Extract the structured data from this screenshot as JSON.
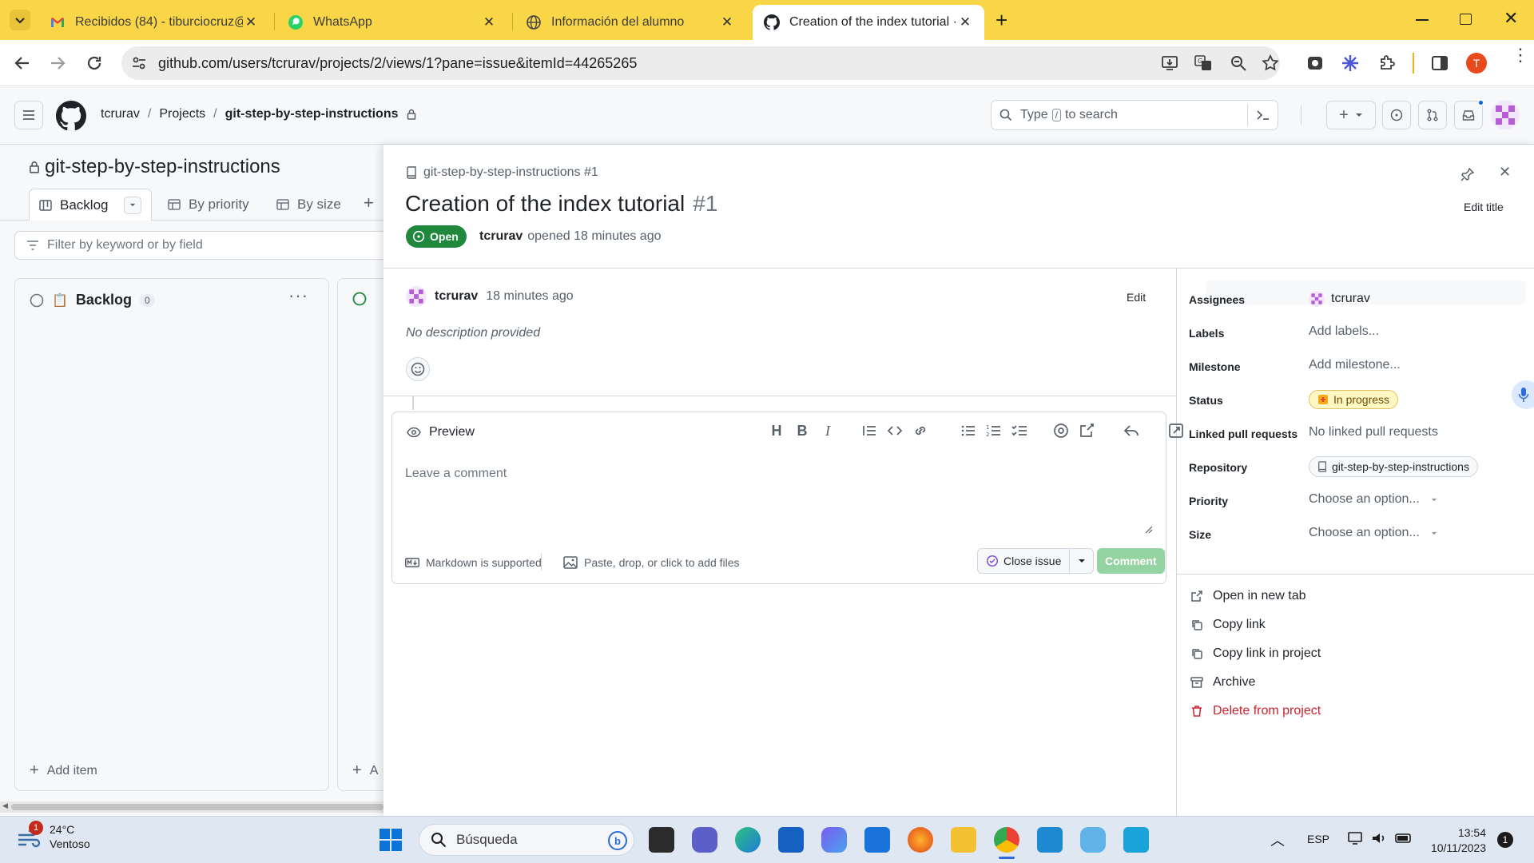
{
  "browser": {
    "tabs": [
      {
        "title": "Recibidos (84) - tiburciocruz@",
        "icon": "gmail-icon"
      },
      {
        "title": "WhatsApp",
        "icon": "whatsapp-icon"
      },
      {
        "title": "Información del alumno",
        "icon": "globe-icon"
      },
      {
        "title": "Creation of the index tutorial · g",
        "icon": "github-icon"
      }
    ],
    "url": "github.com/users/tcrurav/projects/2/views/1?pane=issue&itemId=44265265",
    "profile_letter": "T"
  },
  "github_header": {
    "breadcrumb": [
      "tcrurav",
      "/",
      "Projects",
      "/",
      "git-step-by-step-instructions"
    ],
    "search_placeholder_a": "Type",
    "search_key": "/",
    "search_placeholder_b": "to search",
    "new_button": "+"
  },
  "project": {
    "title": "git-step-by-step-instructions",
    "views": [
      "Backlog",
      "By priority",
      "By size"
    ],
    "add_view": "+",
    "filter_placeholder": "Filter by keyword or by field",
    "columns": [
      {
        "name": "Backlog",
        "count": "0",
        "add_label": "Add item"
      },
      {
        "name": "",
        "count": "",
        "add_label": "A"
      }
    ]
  },
  "issue": {
    "repo_ref": "git-step-by-step-instructions #1",
    "title": "Creation of the index tutorial",
    "number": "#1",
    "edit_title": "Edit title",
    "state": "Open",
    "author": "tcrurav",
    "opened_text": "opened 18 minutes ago",
    "comment_author": "tcrurav",
    "comment_time": "18 minutes ago",
    "comment_edit": "Edit",
    "description": "No description provided",
    "editor": {
      "preview_label": "Preview",
      "placeholder": "Leave a comment",
      "markdown_hint": "Markdown is supported",
      "attach_hint": "Paste, drop, or click to add files",
      "close_button": "Close issue",
      "comment_button": "Comment"
    }
  },
  "sidebar_meta": [
    {
      "label": "Assignees",
      "value": "tcrurav"
    },
    {
      "label": "Labels",
      "value": "Add labels..."
    },
    {
      "label": "Milestone",
      "value": "Add milestone..."
    },
    {
      "label": "Status",
      "value": "In progress"
    },
    {
      "label": "Linked pull requests",
      "value": "No linked pull requests"
    },
    {
      "label": "Repository",
      "value": "git-step-by-step-instructions"
    },
    {
      "label": "Priority",
      "value": "Choose an option..."
    },
    {
      "label": "Size",
      "value": "Choose an option..."
    }
  ],
  "actions": [
    {
      "label": "Open in new tab",
      "icon": "external-link-icon"
    },
    {
      "label": "Copy link",
      "icon": "copy-icon"
    },
    {
      "label": "Copy link in project",
      "icon": "copy-icon"
    },
    {
      "label": "Archive",
      "icon": "archive-icon"
    },
    {
      "label": "Delete from project",
      "icon": "trash-icon"
    }
  ],
  "colors": {
    "tab_strip": "#f9d548",
    "open_badge": "#1f883d",
    "status_badge_bg": "#fff8c5",
    "danger": "#cf222e",
    "comment_button_disabled": "#94d3a2"
  },
  "taskbar": {
    "weather_temp": "24°C",
    "weather_desc": "Ventoso",
    "weather_badge": "1",
    "search_placeholder": "Búsqueda",
    "language": "ESP",
    "time": "13:54",
    "date": "10/11/2023",
    "notification_count": "1"
  }
}
